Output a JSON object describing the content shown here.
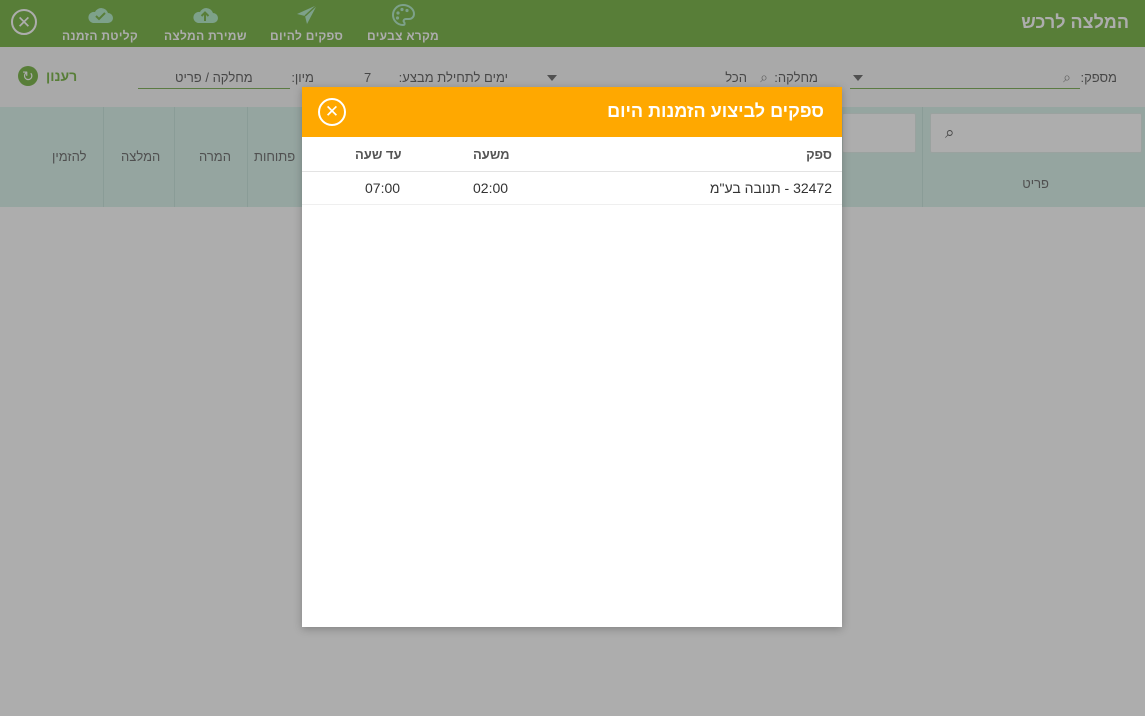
{
  "app": {
    "title": "המלצה לרכש",
    "toolbar": {
      "color_legend": "מקרא צבעים",
      "suppliers_today": "ספקים להיום",
      "save_recommendation": "שמירת המלצה",
      "order_intake": "קליטת הזמנה"
    }
  },
  "filters": {
    "supplier_label": "מספק:",
    "department_label": "מחלקה:",
    "department_value": "הכל",
    "days_label": "ימים לתחילת מבצע:",
    "days_value": "7",
    "sort_label": "מיון:",
    "sort_value": "מחלקה / פריט",
    "refresh_label": "רענון"
  },
  "table": {
    "headers": {
      "item": "פריט",
      "open": "פתוחות",
      "conversion": "המרה",
      "recommendation": "המלצה",
      "to_order": "להזמין"
    }
  },
  "modal": {
    "title": "ספקים לביצוע הזמנות היום",
    "columns": {
      "supplier": "ספק",
      "from_hour": "משעה",
      "to_hour": "עד שעה"
    },
    "rows": [
      {
        "supplier": "32472 - תנובה בע\"מ",
        "from_hour": "02:00",
        "to_hour": "07:00"
      }
    ]
  },
  "colors": {
    "topbar": "#54a014",
    "modal_header": "#ffa800",
    "table_header": "#cfeee5"
  }
}
